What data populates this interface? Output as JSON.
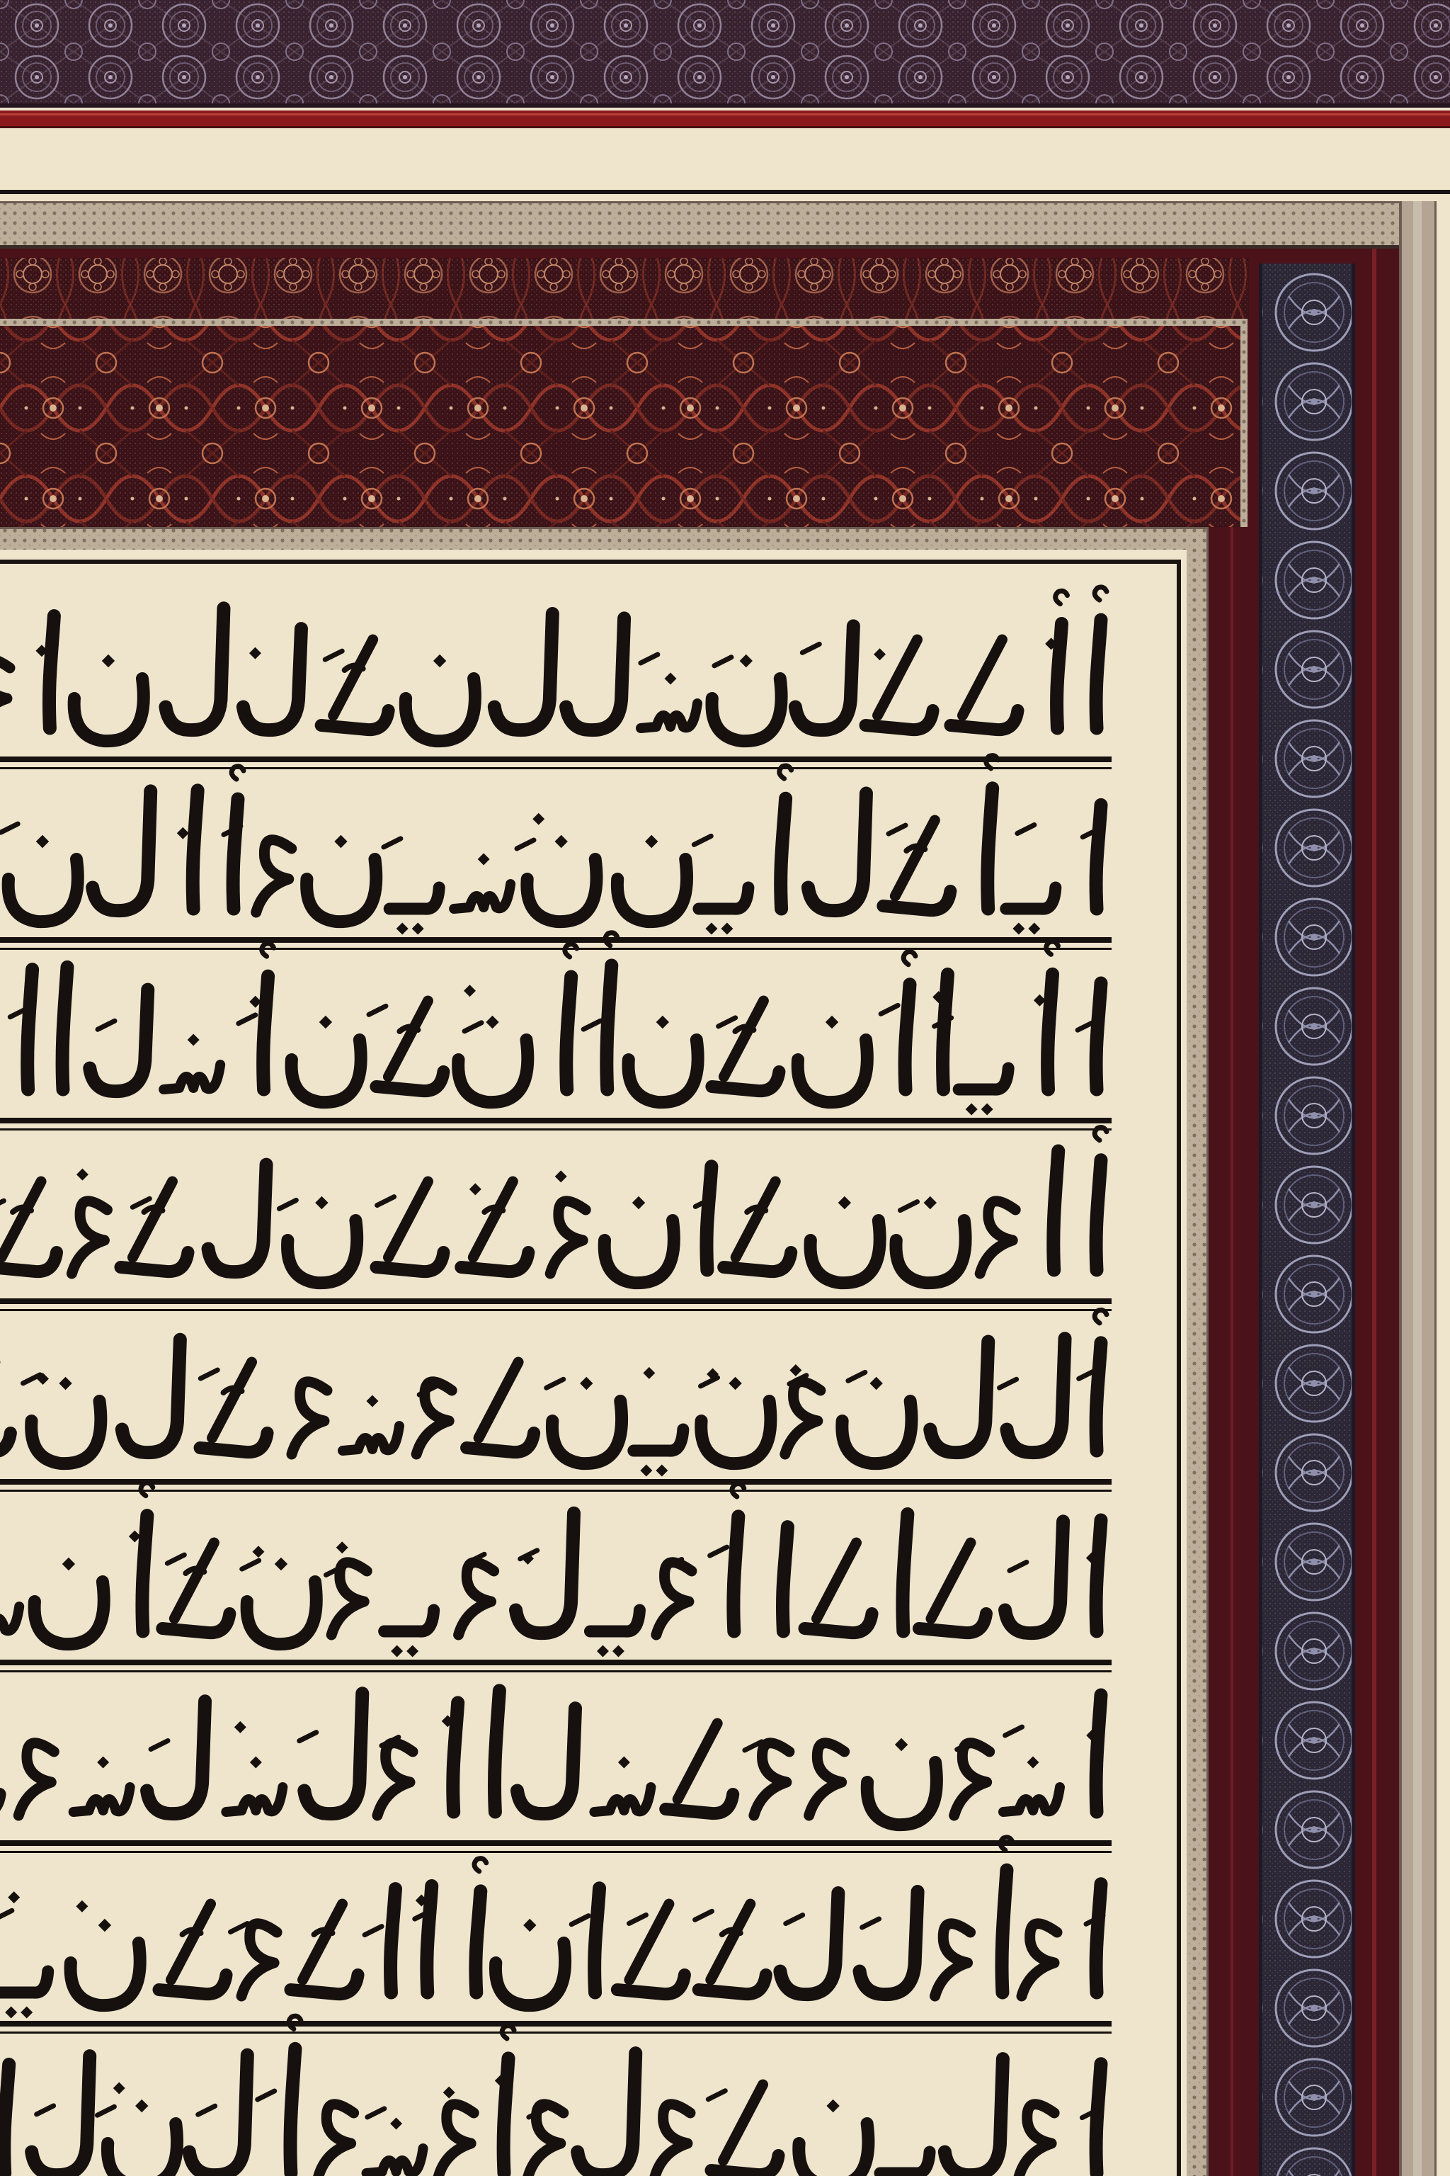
{
  "manuscript": {
    "colors": {
      "paper": "#efe5cd",
      "ink": "#16110e",
      "top_band": "#38222f",
      "red_rule": "#8b1a1c",
      "frame_maroon": "#4b121a",
      "header_panel": "#3a1217",
      "ornament_red": "#8e3026",
      "side_band": "#2b2737",
      "border_beige": "#bcae99",
      "outer_strip": "#b3a494"
    },
    "ornaments": {
      "top_band": "rosette-medallion-pattern",
      "header_panel": "arabesque-lattice-pattern",
      "header_rosettes": "small-rosette-row",
      "side_band": "interlaced-circle-pattern",
      "text_border": "dotted-beige-border"
    }
  }
}
